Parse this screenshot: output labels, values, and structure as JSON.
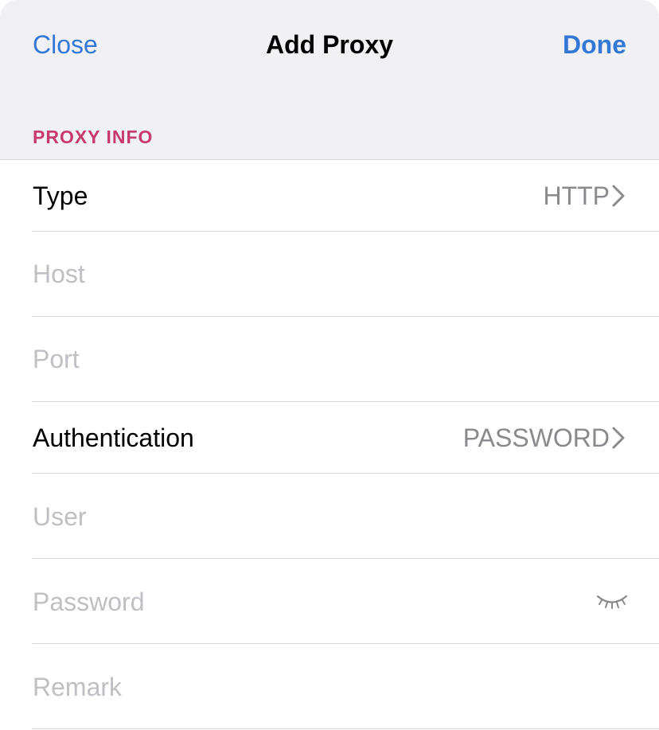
{
  "navbar": {
    "close_label": "Close",
    "title": "Add Proxy",
    "done_label": "Done"
  },
  "section": {
    "header": "PROXY INFO"
  },
  "form": {
    "type": {
      "label": "Type",
      "value": "HTTP"
    },
    "host": {
      "placeholder": "Host",
      "value": ""
    },
    "port": {
      "placeholder": "Port",
      "value": ""
    },
    "authentication": {
      "label": "Authentication",
      "value": "PASSWORD"
    },
    "user": {
      "placeholder": "User",
      "value": ""
    },
    "password": {
      "placeholder": "Password",
      "value": "",
      "toggle_icon": "eye-closed-icon"
    },
    "remark": {
      "placeholder": "Remark",
      "value": ""
    }
  },
  "colors": {
    "accent": "#3478d6",
    "section_header": "#c73a6b",
    "placeholder": "#bfbfc4",
    "detail_value": "#8a8a8e",
    "background": "#f0f0f5"
  }
}
